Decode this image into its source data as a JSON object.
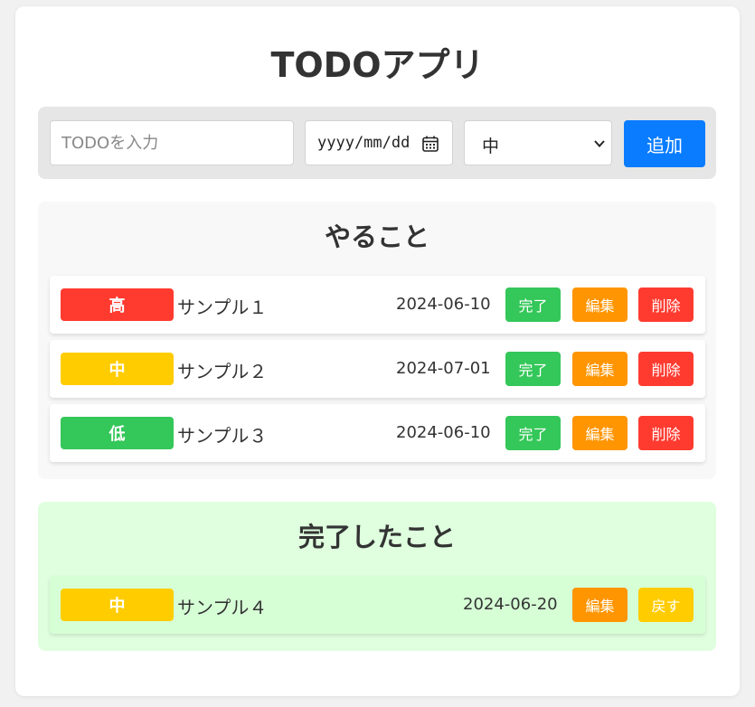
{
  "app_title": "TODOアプリ",
  "form": {
    "text_placeholder": "TODOを入力",
    "date_placeholder": "yyyy/mm/dd",
    "priority_selected": "中",
    "add_label": "追加"
  },
  "todo_section": {
    "title": "やること",
    "items": [
      {
        "priority": "高",
        "text": "サンプル１",
        "date": "2024-06-10",
        "complete_label": "完了",
        "edit_label": "編集",
        "delete_label": "削除"
      },
      {
        "priority": "中",
        "text": "サンプル２",
        "date": "2024-07-01",
        "complete_label": "完了",
        "edit_label": "編集",
        "delete_label": "削除"
      },
      {
        "priority": "低",
        "text": "サンプル３",
        "date": "2024-06-10",
        "complete_label": "完了",
        "edit_label": "編集",
        "delete_label": "削除"
      }
    ]
  },
  "done_section": {
    "title": "完了したこと",
    "items": [
      {
        "priority": "中",
        "text": "サンプル４",
        "date": "2024-06-20",
        "edit_label": "編集",
        "return_label": "戻す"
      }
    ]
  },
  "icons": {
    "calendar": "calendar-icon",
    "select_arrow": "chevron-down-icon"
  },
  "colors": {
    "priority_high": "#ff3b30",
    "priority_medium": "#ffcc00",
    "priority_low": "#34c759",
    "complete": "#34c759",
    "edit": "#ff9500",
    "delete": "#ff3b30",
    "return": "#ffcc00",
    "add": "#0a7cff",
    "done_section_bg": "#dfffdf"
  }
}
